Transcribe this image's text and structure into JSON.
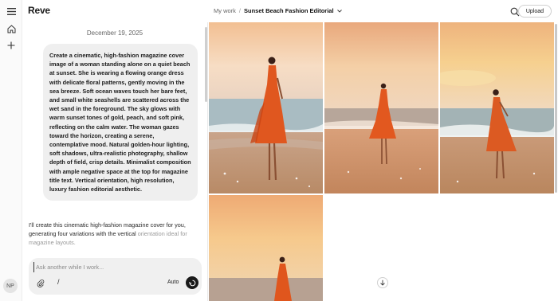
{
  "app": {
    "logo": "Reve"
  },
  "user": {
    "initials": "NP"
  },
  "breadcrumb": {
    "root": "My work",
    "separator": "/",
    "current": "Sunset Beach Fashion Editorial"
  },
  "header": {
    "upload_label": "Upload"
  },
  "chat": {
    "date": "December 19, 2025",
    "prompt": "Create a cinematic, high-fashion magazine cover image of a woman standing alone on a quiet beach at sunset. She is wearing a flowing orange dress with delicate floral patterns, gently moving in the sea breeze. Soft ocean waves touch her bare feet, and small white seashells are scattered across the wet sand in the foreground. The sky glows with warm sunset tones of gold, peach, and soft pink, reflecting on the calm water. The woman gazes toward the horizon, creating a serene, contemplative mood. Natural golden-hour lighting, soft shadows, ultra-realistic photography, shallow depth of field, crisp details. Minimalist composition with ample negative space at the top for magazine title text. Vertical orientation, high resolution, luxury fashion editorial aesthetic.",
    "reply_main": "I'll create this cinematic high-fashion magazine cover for you, generating four variations with the vertical",
    "reply_faded": "orientation ideal for magazine layouts."
  },
  "composer": {
    "placeholder": "Ask another while I work...",
    "mode_label": "Auto",
    "slash_label": "/"
  },
  "colors": {
    "sky_top": "#f3c9a0",
    "sky_mid": "#f6dcc0",
    "sea": "#9fb4bd",
    "sand": "#d9a77c",
    "dress": "#e0571f"
  },
  "icons": [
    "menu-icon",
    "home-icon",
    "plus-icon",
    "search-icon",
    "chevron-down-icon",
    "paperclip-icon",
    "send-icon",
    "arrow-down-icon"
  ]
}
